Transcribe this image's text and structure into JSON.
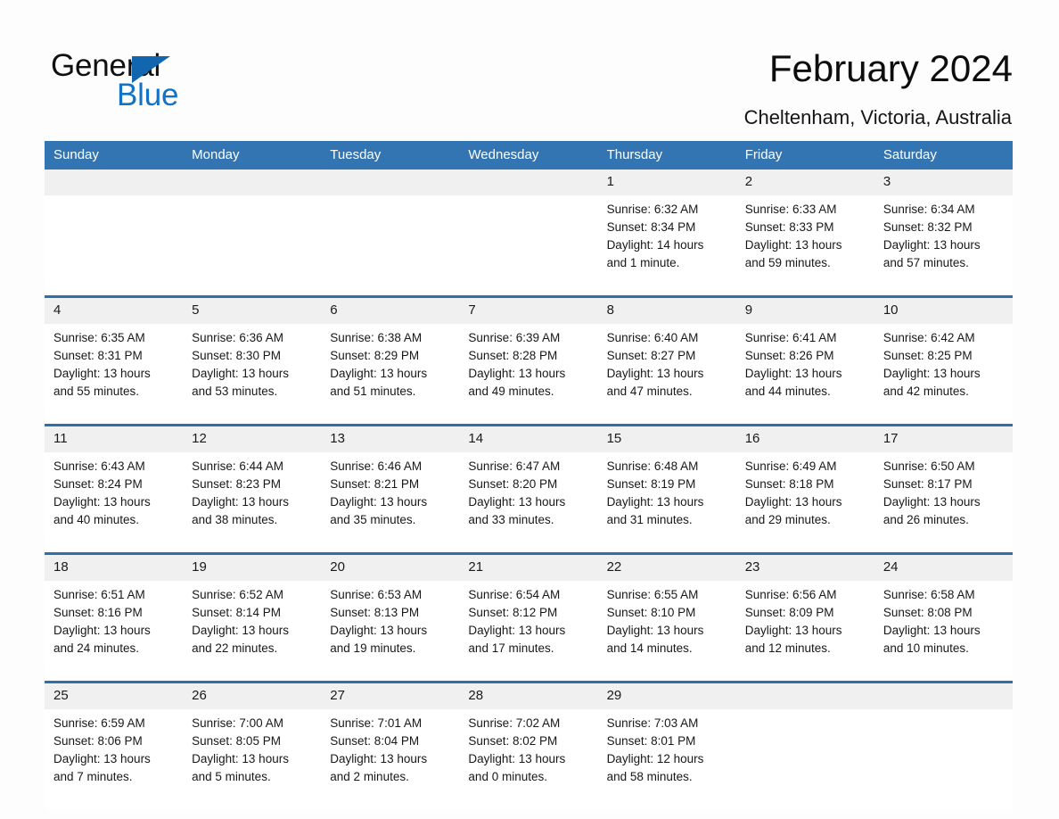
{
  "logo": {
    "word1": "General",
    "word2": "Blue",
    "triangle_color": "#1266b0",
    "blue_color": "#1272c4"
  },
  "header": {
    "title": "February 2024",
    "location": "Cheltenham, Victoria, Australia"
  },
  "theme": {
    "header_blue": "#3375b3",
    "rule_blue": "#2d6fae",
    "daynum_band": "#f0f0f0"
  },
  "weekday_headers": [
    "Sunday",
    "Monday",
    "Tuesday",
    "Wednesday",
    "Thursday",
    "Friday",
    "Saturday"
  ],
  "weeks": [
    {
      "days": [
        {
          "num": "",
          "sunrise": "",
          "sunset": "",
          "daylight1": "",
          "daylight2": ""
        },
        {
          "num": "",
          "sunrise": "",
          "sunset": "",
          "daylight1": "",
          "daylight2": ""
        },
        {
          "num": "",
          "sunrise": "",
          "sunset": "",
          "daylight1": "",
          "daylight2": ""
        },
        {
          "num": "",
          "sunrise": "",
          "sunset": "",
          "daylight1": "",
          "daylight2": ""
        },
        {
          "num": "1",
          "sunrise": "Sunrise: 6:32 AM",
          "sunset": "Sunset: 8:34 PM",
          "daylight1": "Daylight: 14 hours",
          "daylight2": "and 1 minute."
        },
        {
          "num": "2",
          "sunrise": "Sunrise: 6:33 AM",
          "sunset": "Sunset: 8:33 PM",
          "daylight1": "Daylight: 13 hours",
          "daylight2": "and 59 minutes."
        },
        {
          "num": "3",
          "sunrise": "Sunrise: 6:34 AM",
          "sunset": "Sunset: 8:32 PM",
          "daylight1": "Daylight: 13 hours",
          "daylight2": "and 57 minutes."
        }
      ]
    },
    {
      "days": [
        {
          "num": "4",
          "sunrise": "Sunrise: 6:35 AM",
          "sunset": "Sunset: 8:31 PM",
          "daylight1": "Daylight: 13 hours",
          "daylight2": "and 55 minutes."
        },
        {
          "num": "5",
          "sunrise": "Sunrise: 6:36 AM",
          "sunset": "Sunset: 8:30 PM",
          "daylight1": "Daylight: 13 hours",
          "daylight2": "and 53 minutes."
        },
        {
          "num": "6",
          "sunrise": "Sunrise: 6:38 AM",
          "sunset": "Sunset: 8:29 PM",
          "daylight1": "Daylight: 13 hours",
          "daylight2": "and 51 minutes."
        },
        {
          "num": "7",
          "sunrise": "Sunrise: 6:39 AM",
          "sunset": "Sunset: 8:28 PM",
          "daylight1": "Daylight: 13 hours",
          "daylight2": "and 49 minutes."
        },
        {
          "num": "8",
          "sunrise": "Sunrise: 6:40 AM",
          "sunset": "Sunset: 8:27 PM",
          "daylight1": "Daylight: 13 hours",
          "daylight2": "and 47 minutes."
        },
        {
          "num": "9",
          "sunrise": "Sunrise: 6:41 AM",
          "sunset": "Sunset: 8:26 PM",
          "daylight1": "Daylight: 13 hours",
          "daylight2": "and 44 minutes."
        },
        {
          "num": "10",
          "sunrise": "Sunrise: 6:42 AM",
          "sunset": "Sunset: 8:25 PM",
          "daylight1": "Daylight: 13 hours",
          "daylight2": "and 42 minutes."
        }
      ]
    },
    {
      "days": [
        {
          "num": "11",
          "sunrise": "Sunrise: 6:43 AM",
          "sunset": "Sunset: 8:24 PM",
          "daylight1": "Daylight: 13 hours",
          "daylight2": "and 40 minutes."
        },
        {
          "num": "12",
          "sunrise": "Sunrise: 6:44 AM",
          "sunset": "Sunset: 8:23 PM",
          "daylight1": "Daylight: 13 hours",
          "daylight2": "and 38 minutes."
        },
        {
          "num": "13",
          "sunrise": "Sunrise: 6:46 AM",
          "sunset": "Sunset: 8:21 PM",
          "daylight1": "Daylight: 13 hours",
          "daylight2": "and 35 minutes."
        },
        {
          "num": "14",
          "sunrise": "Sunrise: 6:47 AM",
          "sunset": "Sunset: 8:20 PM",
          "daylight1": "Daylight: 13 hours",
          "daylight2": "and 33 minutes."
        },
        {
          "num": "15",
          "sunrise": "Sunrise: 6:48 AM",
          "sunset": "Sunset: 8:19 PM",
          "daylight1": "Daylight: 13 hours",
          "daylight2": "and 31 minutes."
        },
        {
          "num": "16",
          "sunrise": "Sunrise: 6:49 AM",
          "sunset": "Sunset: 8:18 PM",
          "daylight1": "Daylight: 13 hours",
          "daylight2": "and 29 minutes."
        },
        {
          "num": "17",
          "sunrise": "Sunrise: 6:50 AM",
          "sunset": "Sunset: 8:17 PM",
          "daylight1": "Daylight: 13 hours",
          "daylight2": "and 26 minutes."
        }
      ]
    },
    {
      "days": [
        {
          "num": "18",
          "sunrise": "Sunrise: 6:51 AM",
          "sunset": "Sunset: 8:16 PM",
          "daylight1": "Daylight: 13 hours",
          "daylight2": "and 24 minutes."
        },
        {
          "num": "19",
          "sunrise": "Sunrise: 6:52 AM",
          "sunset": "Sunset: 8:14 PM",
          "daylight1": "Daylight: 13 hours",
          "daylight2": "and 22 minutes."
        },
        {
          "num": "20",
          "sunrise": "Sunrise: 6:53 AM",
          "sunset": "Sunset: 8:13 PM",
          "daylight1": "Daylight: 13 hours",
          "daylight2": "and 19 minutes."
        },
        {
          "num": "21",
          "sunrise": "Sunrise: 6:54 AM",
          "sunset": "Sunset: 8:12 PM",
          "daylight1": "Daylight: 13 hours",
          "daylight2": "and 17 minutes."
        },
        {
          "num": "22",
          "sunrise": "Sunrise: 6:55 AM",
          "sunset": "Sunset: 8:10 PM",
          "daylight1": "Daylight: 13 hours",
          "daylight2": "and 14 minutes."
        },
        {
          "num": "23",
          "sunrise": "Sunrise: 6:56 AM",
          "sunset": "Sunset: 8:09 PM",
          "daylight1": "Daylight: 13 hours",
          "daylight2": "and 12 minutes."
        },
        {
          "num": "24",
          "sunrise": "Sunrise: 6:58 AM",
          "sunset": "Sunset: 8:08 PM",
          "daylight1": "Daylight: 13 hours",
          "daylight2": "and 10 minutes."
        }
      ]
    },
    {
      "days": [
        {
          "num": "25",
          "sunrise": "Sunrise: 6:59 AM",
          "sunset": "Sunset: 8:06 PM",
          "daylight1": "Daylight: 13 hours",
          "daylight2": "and 7 minutes."
        },
        {
          "num": "26",
          "sunrise": "Sunrise: 7:00 AM",
          "sunset": "Sunset: 8:05 PM",
          "daylight1": "Daylight: 13 hours",
          "daylight2": "and 5 minutes."
        },
        {
          "num": "27",
          "sunrise": "Sunrise: 7:01 AM",
          "sunset": "Sunset: 8:04 PM",
          "daylight1": "Daylight: 13 hours",
          "daylight2": "and 2 minutes."
        },
        {
          "num": "28",
          "sunrise": "Sunrise: 7:02 AM",
          "sunset": "Sunset: 8:02 PM",
          "daylight1": "Daylight: 13 hours",
          "daylight2": "and 0 minutes."
        },
        {
          "num": "29",
          "sunrise": "Sunrise: 7:03 AM",
          "sunset": "Sunset: 8:01 PM",
          "daylight1": "Daylight: 12 hours",
          "daylight2": "and 58 minutes."
        },
        {
          "num": "",
          "sunrise": "",
          "sunset": "",
          "daylight1": "",
          "daylight2": ""
        },
        {
          "num": "",
          "sunrise": "",
          "sunset": "",
          "daylight1": "",
          "daylight2": ""
        }
      ]
    }
  ]
}
